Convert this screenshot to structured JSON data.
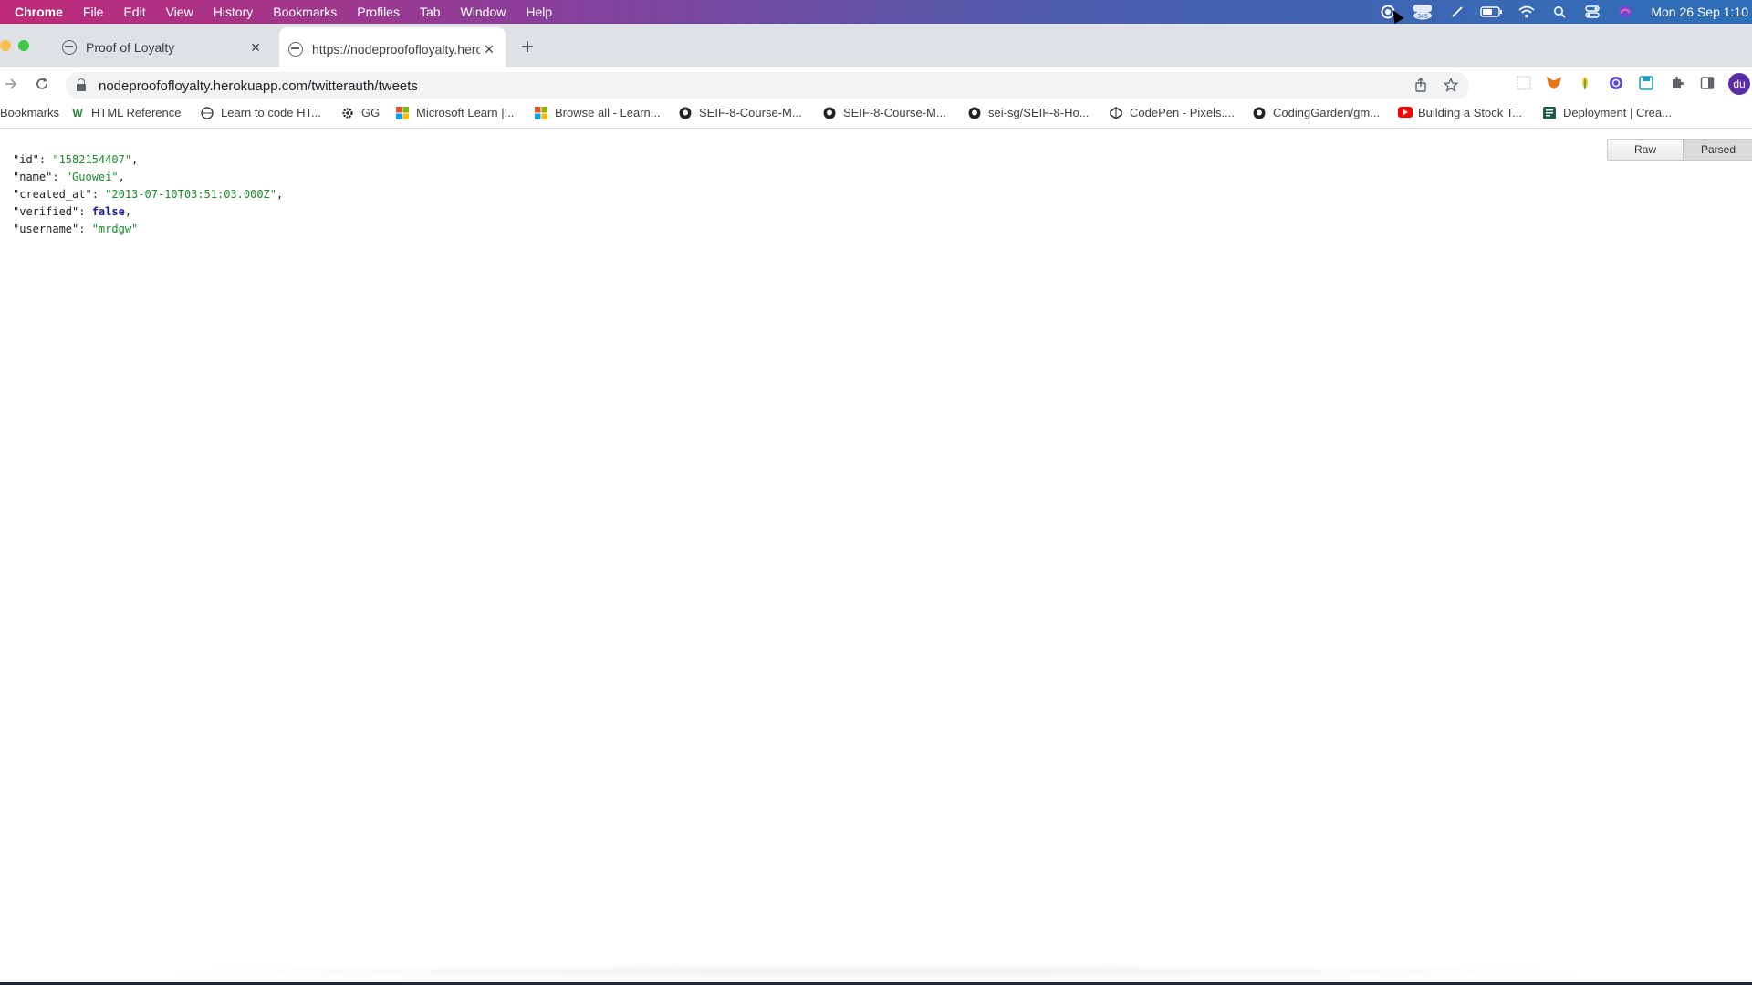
{
  "menubar": {
    "app": "Chrome",
    "items": [
      "File",
      "Edit",
      "View",
      "History",
      "Bookmarks",
      "Profiles",
      "Tab",
      "Window",
      "Help"
    ],
    "badge": "345",
    "clock": "Mon 26 Sep  1:10"
  },
  "tabs": [
    {
      "title": "Proof of Loyalty",
      "close": "×"
    },
    {
      "title": "https://nodeproofofloyalty.hero",
      "close": "×"
    }
  ],
  "new_tab": "+",
  "toolbar": {
    "url": "nodeproofofloyalty.herokuapp.com/twitterauth/tweets",
    "avatar": "du"
  },
  "bookmarks": [
    {
      "label": "Bookmarks",
      "icon": "none"
    },
    {
      "label": "HTML Reference",
      "icon": "w3schools-icon"
    },
    {
      "label": "Learn to code HT...",
      "icon": "globe-icon"
    },
    {
      "label": "GG",
      "icon": "gear-icon"
    },
    {
      "label": "Microsoft Learn |...",
      "icon": "microsoft-icon"
    },
    {
      "label": "Browse all - Learn...",
      "icon": "microsoft-icon"
    },
    {
      "label": "SEIF-8-Course-M...",
      "icon": "github-icon"
    },
    {
      "label": "SEIF-8-Course-M...",
      "icon": "github-icon"
    },
    {
      "label": "sei-sg/SEIF-8-Ho...",
      "icon": "github-icon"
    },
    {
      "label": "CodePen - Pixels....",
      "icon": "codepen-icon"
    },
    {
      "label": "CodingGarden/gm...",
      "icon": "github-icon"
    },
    {
      "label": "Building a Stock T...",
      "icon": "youtube-icon"
    },
    {
      "label": "Deployment | Crea...",
      "icon": "page-icon"
    }
  ],
  "viewer": {
    "raw": "Raw",
    "parsed": "Parsed"
  },
  "json": {
    "id_key": "\"id\"",
    "id_val": "\"1582154407\"",
    "name_key": "\"name\"",
    "name_val": "\"Guowei\"",
    "created_key": "\"created_at\"",
    "created_val": "\"2013-07-10T03:51:03.000Z\"",
    "verified_key": "\"verified\"",
    "verified_val": "false",
    "username_key": "\"username\"",
    "username_val": "\"mrdgw\""
  },
  "colors": {
    "string": "#1a8a2a",
    "boolean": "#1a1aa6",
    "tab_bg": "#dee1e6",
    "avatar": "#5b2ea6"
  }
}
